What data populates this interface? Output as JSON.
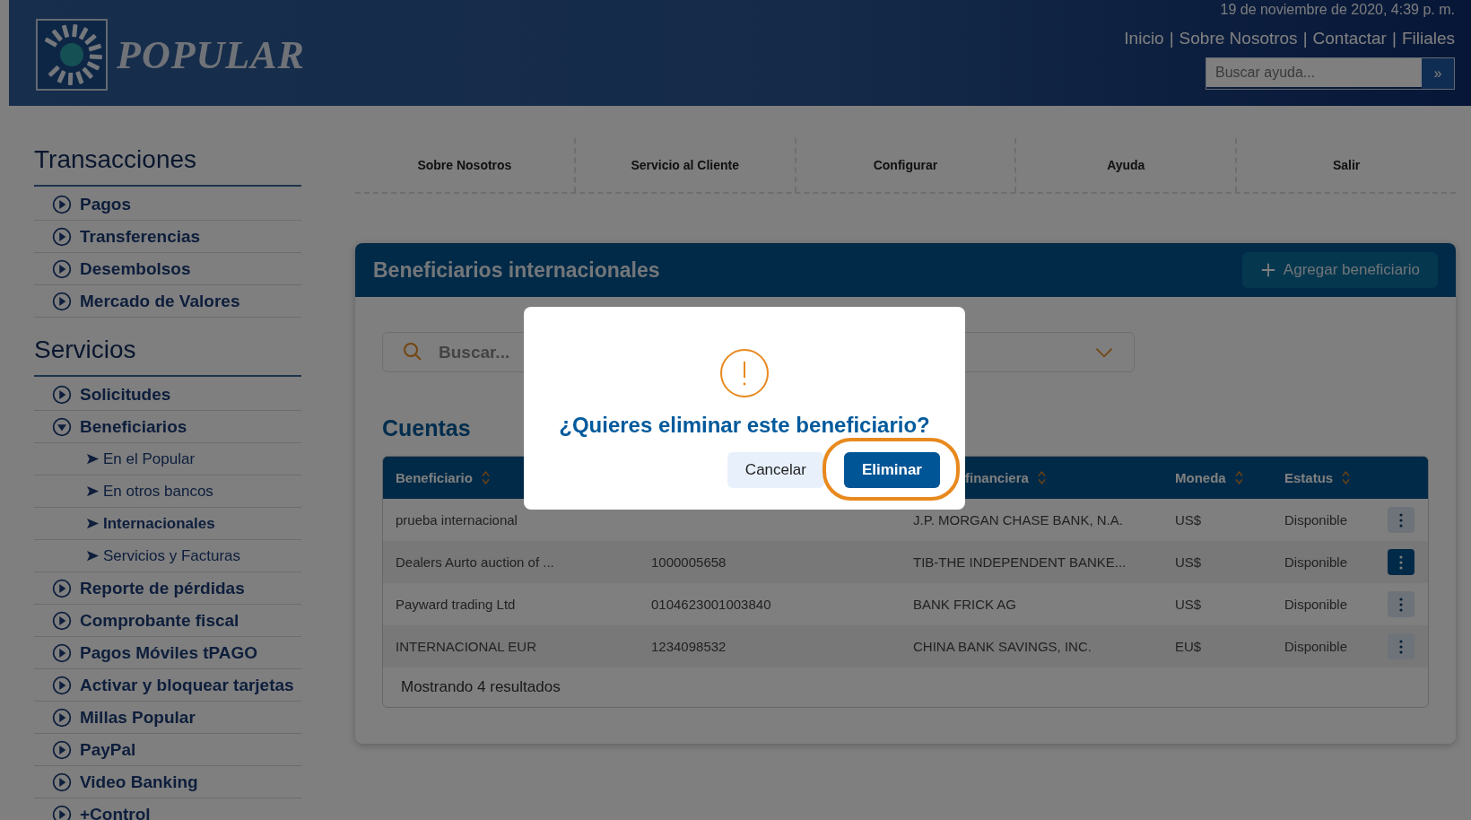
{
  "header": {
    "logo_text": "POPULAR",
    "date": "19 de noviembre de 2020, 4:39 p. m.",
    "separator": "|",
    "links": [
      "Inicio",
      "Sobre Nosotros",
      "Contactar",
      "Filiales"
    ],
    "search": {
      "placeholder": "Buscar ayuda...",
      "button": "»"
    }
  },
  "sidebar": {
    "sections": [
      {
        "title": "Transacciones",
        "items": [
          {
            "label": "Pagos",
            "expanded": false
          },
          {
            "label": "Transferencias",
            "expanded": false
          },
          {
            "label": "Desembolsos",
            "expanded": false
          },
          {
            "label": "Mercado de Valores",
            "expanded": false
          }
        ]
      },
      {
        "title": "Servicios",
        "items": [
          {
            "label": "Solicitudes",
            "expanded": false
          },
          {
            "label": "Beneficiarios",
            "expanded": true,
            "children": [
              {
                "label": "En el Popular",
                "selected": false
              },
              {
                "label": "En otros bancos",
                "selected": false
              },
              {
                "label": "Internacionales",
                "selected": true
              },
              {
                "label": "Servicios y Facturas",
                "selected": false
              }
            ]
          },
          {
            "label": "Reporte de pérdidas",
            "expanded": false
          },
          {
            "label": "Comprobante fiscal",
            "expanded": false
          },
          {
            "label": "Pagos Móviles tPAGO",
            "expanded": false
          },
          {
            "label": "Activar y bloquear tarjetas",
            "expanded": false
          },
          {
            "label": "Millas Popular",
            "expanded": false
          },
          {
            "label": "PayPal",
            "expanded": false
          },
          {
            "label": "Video Banking",
            "expanded": false
          },
          {
            "label": "+Control",
            "expanded": false
          }
        ]
      }
    ]
  },
  "nav": [
    "Sobre Nosotros",
    "Servicio al Cliente",
    "Configurar",
    "Ayuda",
    "Salir"
  ],
  "panel": {
    "title": "Beneficiarios internacionales",
    "add_button": "Agregar beneficiario",
    "search": {
      "placeholder": "Buscar..."
    },
    "section_title": "Cuentas",
    "table": {
      "columns": [
        {
          "label": "Beneficiario"
        },
        {},
        {
          "label": "financiera"
        },
        {
          "label": "Moneda"
        },
        {
          "label": "Estatus"
        }
      ],
      "rows": [
        {
          "beneficiary": "prueba internacional",
          "bank": "J.P. MORGAN CHASE BANK, N.A.",
          "currency": "US$",
          "status": "Disponible",
          "menu_active": false
        },
        {
          "beneficiary": "Dealers Aurto auction of ...",
          "account": "1000005658",
          "bank": "TIB-THE INDEPENDENT BANKE...",
          "currency": "US$",
          "status": "Disponible",
          "menu_active": true
        },
        {
          "beneficiary": "Payward trading Ltd",
          "account": "0104623001003840",
          "bank": "BANK FRICK AG",
          "currency": "US$",
          "status": "Disponible",
          "menu_active": false
        },
        {
          "beneficiary": "INTERNACIONAL EUR",
          "account": "1234098532",
          "bank": "CHINA BANK SAVINGS, INC.",
          "currency": "EU$",
          "status": "Disponible",
          "menu_active": false
        }
      ],
      "footer": "Mostrando 4 resultados"
    }
  },
  "dialog": {
    "title": "¿Quieres eliminar este beneficiario?",
    "buttons": [
      {
        "label": "Cancelar",
        "kind": "secondary",
        "highlighted": false
      },
      {
        "label": "Eliminar",
        "kind": "primary",
        "highlighted": true
      }
    ]
  }
}
